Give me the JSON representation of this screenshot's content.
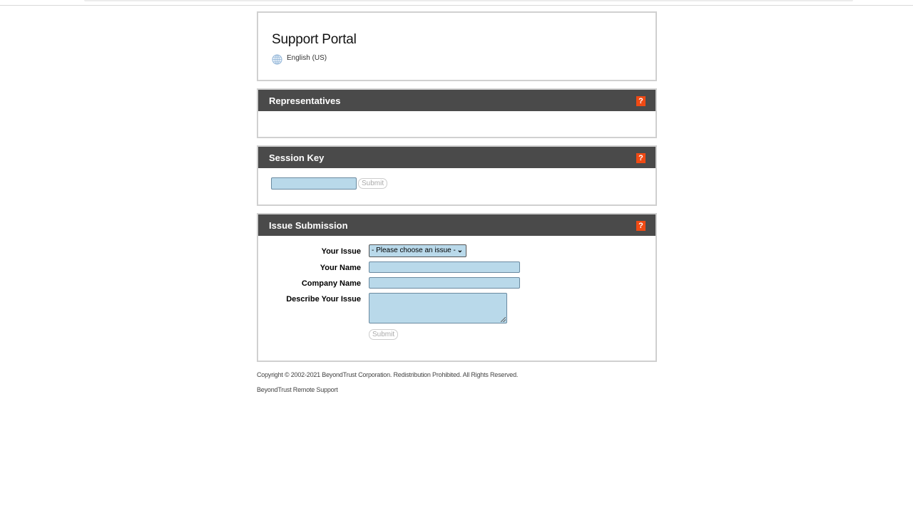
{
  "header": {
    "title": "Support Portal",
    "language": "English (US)"
  },
  "sections": {
    "representatives": {
      "title": "Representatives",
      "help": "?"
    },
    "session_key": {
      "title": "Session Key",
      "help": "?",
      "input_value": "",
      "submit_label": "Submit"
    },
    "issue_submission": {
      "title": "Issue Submission",
      "help": "?",
      "your_issue_label": "Your Issue",
      "your_issue_selected": "- Please choose an issue -",
      "your_name_label": "Your Name",
      "company_name_label": "Company Name",
      "describe_label": "Describe Your Issue",
      "submit_label": "Submit"
    }
  },
  "footer": {
    "copyright": "Copyright © 2002-2021 BeyondTrust Corporation. Redistribution Prohibited. All Rights Reserved.",
    "product": "BeyondTrust Remote Support"
  },
  "colors": {
    "section_header": "#4a4a4a",
    "help_icon": "#f04a14",
    "input_fill": "#b9d9ea"
  }
}
